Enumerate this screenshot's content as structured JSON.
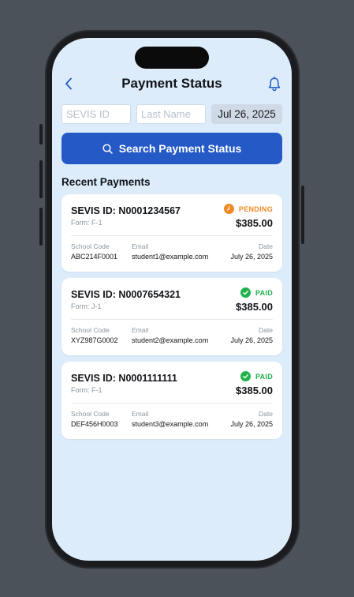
{
  "header": {
    "title": "Payment Status",
    "back_icon": "chevron-left-icon",
    "notification_icon": "bell-icon"
  },
  "search": {
    "sevis_placeholder": "SEVIS ID",
    "sevis_value": "",
    "lastname_placeholder": "Last Name",
    "lastname_value": "",
    "date": "Jul 26, 2025",
    "button_label": "Search Payment Status",
    "button_icon": "search-icon"
  },
  "recent": {
    "title": "Recent Payments",
    "labels": {
      "school": "School Code",
      "email": "Email",
      "date": "Date"
    },
    "payments": [
      {
        "sevis": "SEVIS ID: N0001234567",
        "form": "Form: F-1",
        "status": "PENDING",
        "status_icon": "clock-icon",
        "amount": "$385.00",
        "school": "ABC214F0001",
        "email": "student1@example.com",
        "date": "July 26, 2025"
      },
      {
        "sevis": "SEVIS ID: N0007654321",
        "form": "Form: J-1",
        "status": "PAID",
        "status_icon": "check-circle-icon",
        "amount": "$385.00",
        "school": "XYZ987G0002",
        "email": "student2@example.com",
        "date": "July 26, 2025"
      },
      {
        "sevis": "SEVIS ID: N0001111111",
        "form": "Form: F-1",
        "status": "PAID",
        "status_icon": "check-circle-icon",
        "amount": "$385.00",
        "school": "DEF456H0003",
        "email": "student3@example.com",
        "date": "July 26, 2025"
      }
    ]
  },
  "colors": {
    "background": "#4b5259",
    "screen": "#dcecfb",
    "accent": "#2459c6",
    "pending": "#f08a24",
    "paid": "#22b24c"
  }
}
